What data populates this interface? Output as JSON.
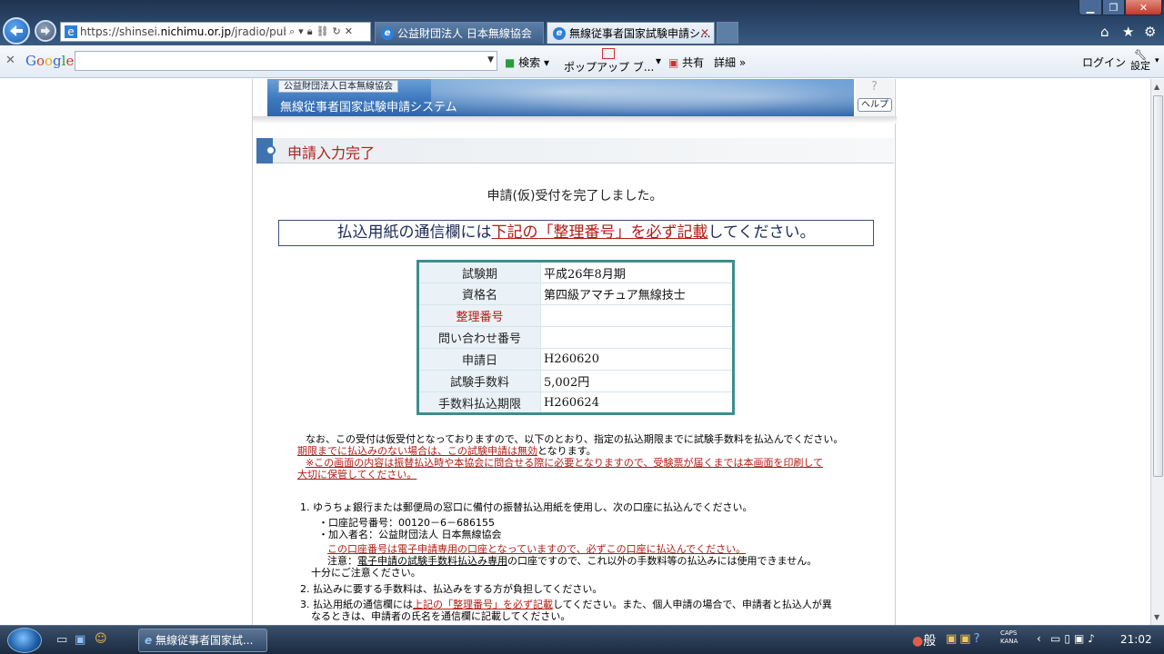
{
  "browser": {
    "address_url_prefix": "https://shinsei.",
    "address_url_domain": "nichimu.or.jp",
    "address_url_suffix": "/jradio/public",
    "tabs": [
      {
        "label": "公益財団法人 日本無線協会"
      },
      {
        "label": "無線従事者国家試験申請シ..."
      }
    ]
  },
  "google_toolbar": {
    "logo": [
      "G",
      "o",
      "o",
      "g",
      "l",
      "e"
    ],
    "search_label": "検索",
    "popup_label": "ポップアップ ブ...",
    "share_label": "共有",
    "more_label": "詳細 »",
    "login_label": "ログイン",
    "settings_label": "設定"
  },
  "header": {
    "org_label": "公益財団法人日本無線協会",
    "system_title": "無線従事者国家試験申請システム",
    "help_q": "?",
    "help_label": "ヘルプ"
  },
  "section": {
    "title": "申請入力完了"
  },
  "completion_message": "申請(仮)受付を完了しました。",
  "notice": {
    "before": "払込用紙の通信欄には",
    "emphasis": "下記の「整理番号」を必ず記載",
    "after": "してください。"
  },
  "info_rows": [
    {
      "label": "試験期",
      "value": "平成26年8月期"
    },
    {
      "label": "資格名",
      "value": "第四級アマチュア無線技士"
    },
    {
      "label": "整理番号",
      "value": ""
    },
    {
      "label": "問い合わせ番号",
      "value": ""
    },
    {
      "label": "申請日",
      "value": "H260620"
    },
    {
      "label": "試験手数料",
      "value": "5,002円"
    },
    {
      "label": "手数料払込期限",
      "value": "H260624"
    }
  ],
  "notes": {
    "p1": "なお、この受付は仮受付となっておりますので、以下のとおり、指定の払込期限までに試験手数料を払込んでください。",
    "p2_red": "期限までに払込みのない場合は、この試験申請は無効",
    "p2_rest": "となります。",
    "p3_line1": "※この画面の内容は振替払込時や本協会に問合せる際に必要となりますので、受験票が届くまでは本画面を印刷して",
    "p3_line2": "大切に保管してください。",
    "item1": "1. ゆうちょ銀行または郵便局の窓口に備付の振替払込用紙を使用し、次の口座に払込んでください。",
    "account_no": "・口座記号番号：00120－6－686155",
    "account_name": "・加入者名：公益財団法人 日本無線協会",
    "account_warning": "この口座番号は電子申請専用の口座となっていますので、必ずこの口座に払込んでください。",
    "caution_prefix": "注意：",
    "caution_ul": "電子申請の試験手数料払込み専用",
    "caution_rest": "の口座ですので、これ以外の手数料等の払込みには使用できません。",
    "caution_line2": "十分にご注意ください。",
    "item2": "2. 払込みに要する手数料は、払込みをする方が負担してください。",
    "item3_prefix": "3. 払込用紙の通信欄には",
    "item3_red": "上記の「整理番号」を必ず記載",
    "item3_rest": "してください。また、個人申請の場合で、申請者と払込人が異",
    "item3_line2": "なるときは、申請者の氏名を通信欄に記載してください。"
  },
  "taskbar": {
    "task_label": "無線従事者国家試...",
    "ime_label": "般",
    "caps_label": "CAPS",
    "kana_label": "KANA",
    "clock": "21:02"
  },
  "colors": {
    "accent_red": "#b21b14",
    "table_border": "#3a8f8f",
    "section_blue": "#3f74b0"
  }
}
